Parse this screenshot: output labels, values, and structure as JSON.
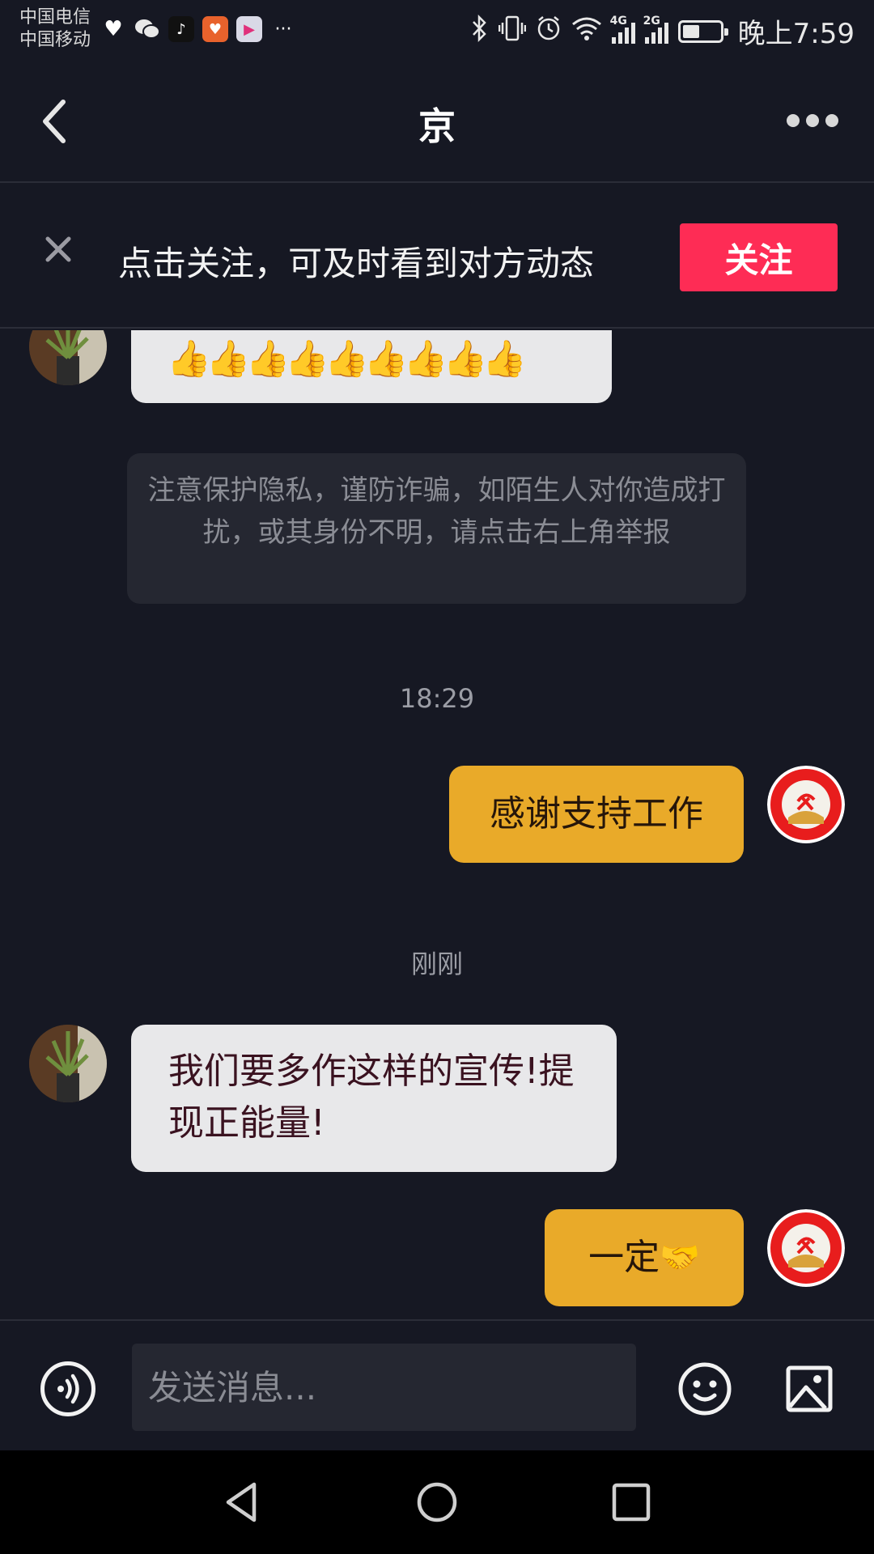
{
  "status_bar": {
    "carrier_1": "中国电信",
    "carrier_2": "中国移动",
    "notification_icons": [
      "heartbeat-icon",
      "wechat-icon",
      "tiktok-icon",
      "orange-app-icon",
      "video-app-icon",
      "more-dots-icon"
    ],
    "indicators": [
      "bluetooth-icon",
      "vibrate-icon",
      "alarm-icon",
      "wifi-icon"
    ],
    "signal_1_label": "4G",
    "signal_2_label": "2G",
    "battery_level": 0.45,
    "time": "晚上7:59"
  },
  "nav": {
    "title": "京"
  },
  "follow_banner": {
    "text": "点击关注，可及时看到对方动态",
    "button_label": "关注"
  },
  "messages": {
    "incoming_thumbs": "👍👍👍👍👍👍👍👍👍",
    "privacy_notice": "注意保护隐私，谨防诈骗，如陌生人对你造成打扰，或其身份不明，请点击右上角举报",
    "time_1": "18:29",
    "outgoing_1": "感谢支持工作",
    "time_2": "刚刚",
    "incoming_2": "我们要多作这样的宣传!提现正能量!",
    "outgoing_2_text": "一定",
    "outgoing_2_emoji": "🤝"
  },
  "input_bar": {
    "placeholder": "发送消息..."
  },
  "colors": {
    "background": "#161823",
    "follow_button": "#fe2c55",
    "outgoing_bubble": "#e9aa29",
    "incoming_bubble": "#e8e8ea"
  }
}
